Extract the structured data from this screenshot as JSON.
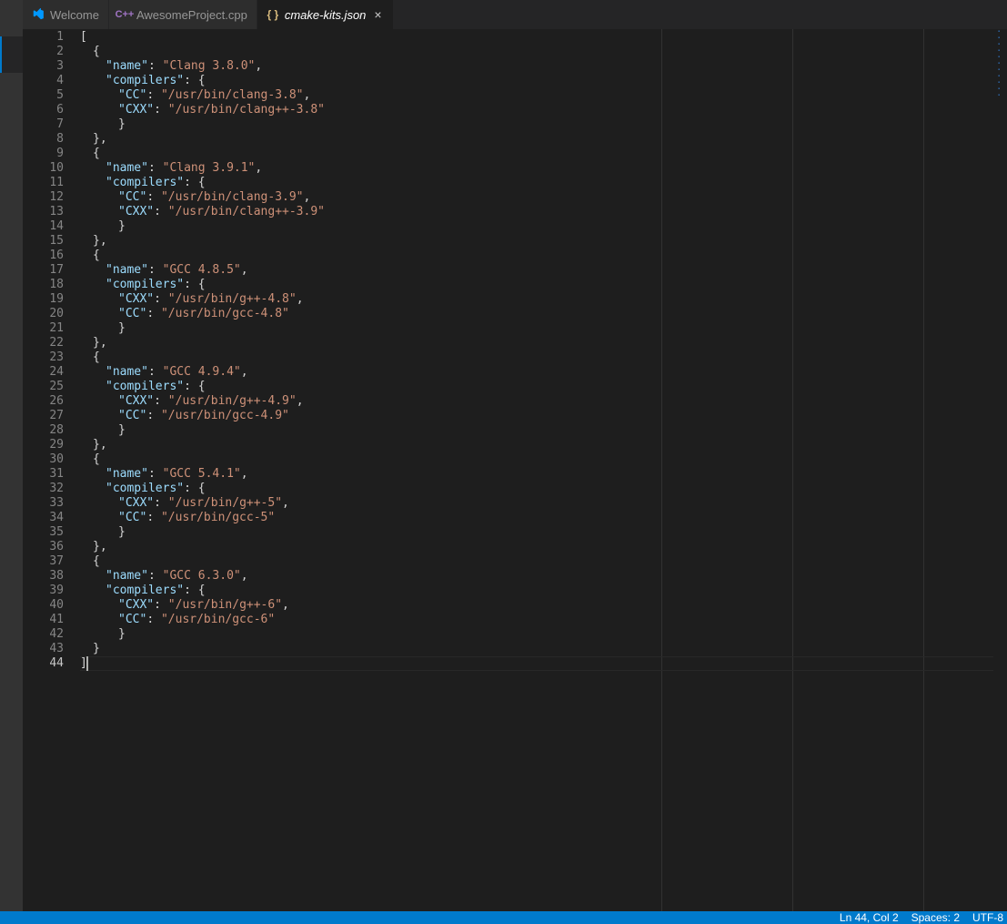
{
  "tabs": [
    {
      "label": "Welcome",
      "icon": "vscode"
    },
    {
      "label": "AwesomeProject.cpp",
      "icon": "cpp"
    },
    {
      "label": "cmake-kits.json",
      "icon": "json",
      "active": true,
      "italic": true
    }
  ],
  "rulers": [
    80,
    100,
    120
  ],
  "cursor": {
    "line": 44,
    "col": 2
  },
  "status": {
    "position": "Ln 44, Col 2",
    "spaces": "Spaces: 2",
    "encoding": "UTF-8"
  },
  "kits": [
    {
      "name": "Clang 3.8.0",
      "compilers": {
        "CC": "/usr/bin/clang-3.8",
        "CXX": "/usr/bin/clang++-3.8"
      },
      "order": [
        "CC",
        "CXX"
      ]
    },
    {
      "name": "Clang 3.9.1",
      "compilers": {
        "CC": "/usr/bin/clang-3.9",
        "CXX": "/usr/bin/clang++-3.9"
      },
      "order": [
        "CC",
        "CXX"
      ]
    },
    {
      "name": "GCC 4.8.5",
      "compilers": {
        "CXX": "/usr/bin/g++-4.8",
        "CC": "/usr/bin/gcc-4.8"
      },
      "order": [
        "CXX",
        "CC"
      ]
    },
    {
      "name": "GCC 4.9.4",
      "compilers": {
        "CXX": "/usr/bin/g++-4.9",
        "CC": "/usr/bin/gcc-4.9"
      },
      "order": [
        "CXX",
        "CC"
      ]
    },
    {
      "name": "GCC 5.4.1",
      "compilers": {
        "CXX": "/usr/bin/g++-5",
        "CC": "/usr/bin/gcc-5"
      },
      "order": [
        "CXX",
        "CC"
      ]
    },
    {
      "name": "GCC 6.3.0",
      "compilers": {
        "CXX": "/usr/bin/g++-6",
        "CC": "/usr/bin/gcc-6"
      },
      "order": [
        "CXX",
        "CC"
      ]
    }
  ]
}
